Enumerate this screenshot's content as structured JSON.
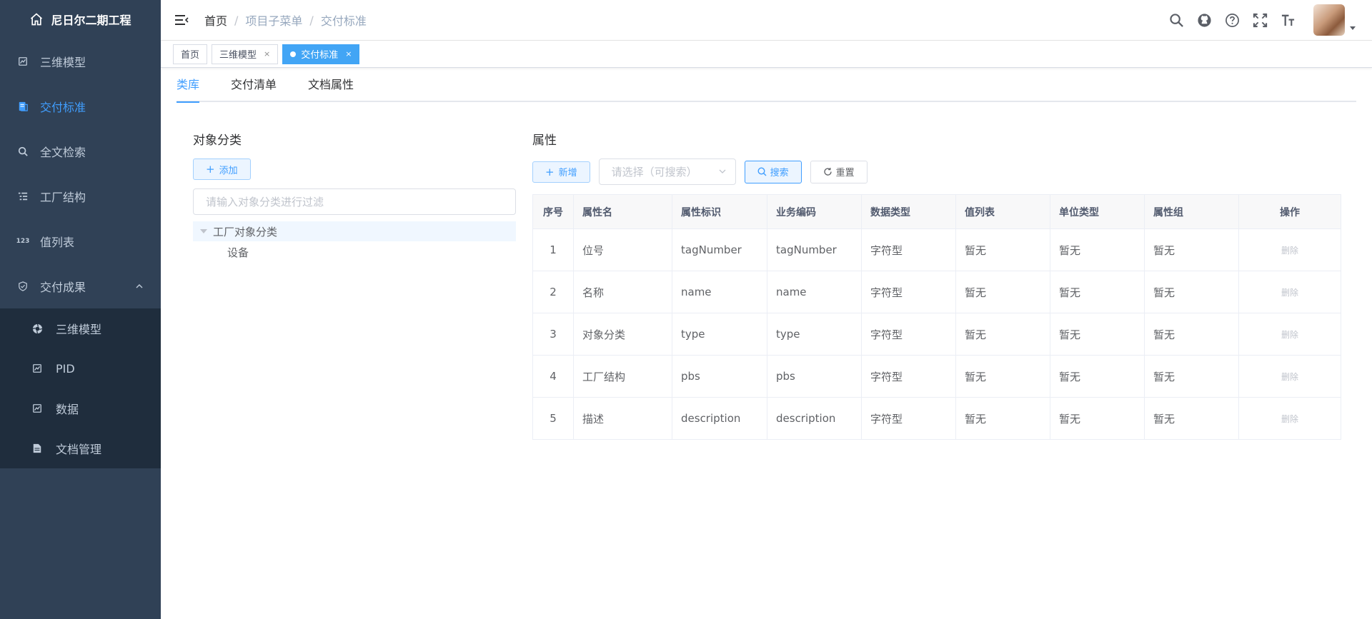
{
  "sidebar": {
    "title": "尼日尔二期工程",
    "items": [
      {
        "label": "三维模型",
        "icon": "model-icon"
      },
      {
        "label": "交付标准",
        "icon": "doc-icon",
        "active": true
      },
      {
        "label": "全文检索",
        "icon": "search-icon"
      },
      {
        "label": "工厂结构",
        "icon": "tree-list-icon"
      },
      {
        "label": "值列表",
        "icon": "number-list-icon"
      },
      {
        "label": "交付成果",
        "icon": "shield-check-icon",
        "expanded": true
      }
    ],
    "subitems": [
      {
        "label": "三维模型",
        "icon": "aperture-icon"
      },
      {
        "label": "PID",
        "icon": "chart-icon"
      },
      {
        "label": "数据",
        "icon": "chart-icon"
      },
      {
        "label": "文档管理",
        "icon": "document-icon"
      }
    ]
  },
  "header": {
    "breadcrumb": [
      "首页",
      "项目子菜单",
      "交付标准"
    ]
  },
  "tags": {
    "items": [
      {
        "label": "首页",
        "closable": false
      },
      {
        "label": "三维模型",
        "closable": true
      },
      {
        "label": "交付标准",
        "closable": true,
        "active": true
      }
    ],
    "close_glyph": "×"
  },
  "tabs": [
    "类库",
    "交付清单",
    "文档属性"
  ],
  "left_panel": {
    "title": "对象分类",
    "add_label": "添加",
    "filter_placeholder": "请输入对象分类进行过滤",
    "tree": {
      "root": "工厂对象分类",
      "children": [
        "设备"
      ]
    }
  },
  "right_panel": {
    "title": "属性",
    "new_label": "新增",
    "select_placeholder": "请选择（可搜索）",
    "search_label": "搜索",
    "reset_label": "重置",
    "table": {
      "headers": [
        "序号",
        "属性名",
        "属性标识",
        "业务编码",
        "数据类型",
        "值列表",
        "单位类型",
        "属性组",
        "操作"
      ],
      "rows": [
        [
          "1",
          "位号",
          "tagNumber",
          "tagNumber",
          "字符型",
          "暂无",
          "暂无",
          "暂无",
          "删除"
        ],
        [
          "2",
          "名称",
          "name",
          "name",
          "字符型",
          "暂无",
          "暂无",
          "暂无",
          "删除"
        ],
        [
          "3",
          "对象分类",
          "type",
          "type",
          "字符型",
          "暂无",
          "暂无",
          "暂无",
          "删除"
        ],
        [
          "4",
          "工厂结构",
          "pbs",
          "pbs",
          "字符型",
          "暂无",
          "暂无",
          "暂无",
          "删除"
        ],
        [
          "5",
          "描述",
          "description",
          "description",
          "字符型",
          "暂无",
          "暂无",
          "暂无",
          "删除"
        ]
      ]
    }
  },
  "colors": {
    "sidebar_bg": "#304156",
    "sidebar_sub_bg": "#1f2d3d",
    "accent": "#409eff",
    "tag_active": "#42a5f5"
  }
}
